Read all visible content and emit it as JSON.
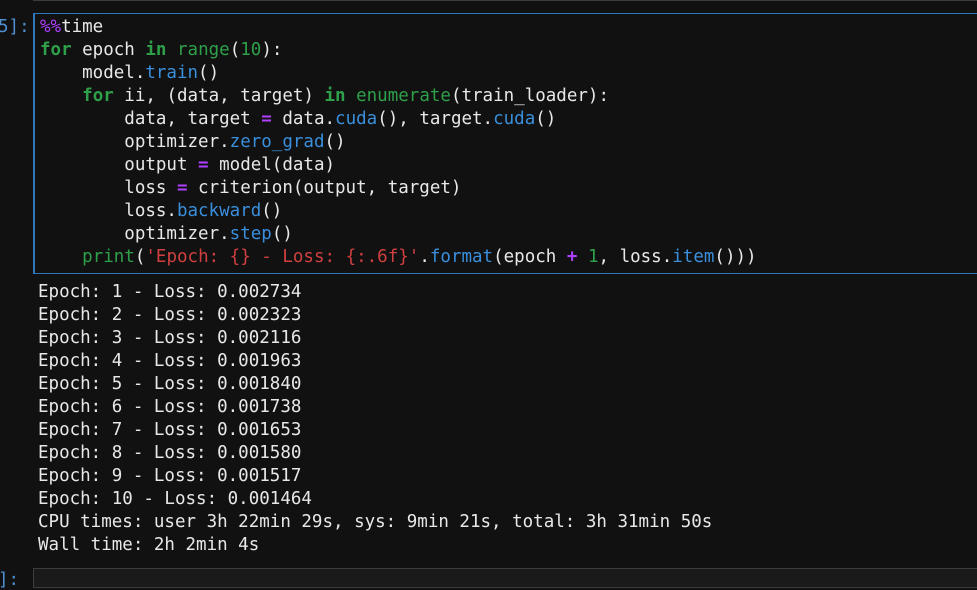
{
  "cell": {
    "prompt": "5]:",
    "next_prompt": "]:",
    "code_lines": [
      [
        {
          "t": "%%",
          "c": "magic"
        },
        {
          "t": "time",
          "c": ""
        }
      ],
      [
        {
          "t": "for",
          "c": "kw"
        },
        {
          "t": " epoch ",
          "c": ""
        },
        {
          "t": "in",
          "c": "kw"
        },
        {
          "t": " ",
          "c": ""
        },
        {
          "t": "range",
          "c": "bi"
        },
        {
          "t": "(",
          "c": ""
        },
        {
          "t": "10",
          "c": "num"
        },
        {
          "t": "):",
          "c": ""
        }
      ],
      [
        {
          "t": "    model.",
          "c": ""
        },
        {
          "t": "train",
          "c": "fn"
        },
        {
          "t": "()",
          "c": ""
        }
      ],
      [
        {
          "t": "    ",
          "c": ""
        },
        {
          "t": "for",
          "c": "kw"
        },
        {
          "t": " ii, (data, target) ",
          "c": ""
        },
        {
          "t": "in",
          "c": "kw"
        },
        {
          "t": " ",
          "c": ""
        },
        {
          "t": "enumerate",
          "c": "bi"
        },
        {
          "t": "(train_loader):",
          "c": ""
        }
      ],
      [
        {
          "t": "        data, target ",
          "c": ""
        },
        {
          "t": "=",
          "c": "op"
        },
        {
          "t": " data.",
          "c": ""
        },
        {
          "t": "cuda",
          "c": "fn"
        },
        {
          "t": "(), target.",
          "c": ""
        },
        {
          "t": "cuda",
          "c": "fn"
        },
        {
          "t": "()",
          "c": ""
        }
      ],
      [
        {
          "t": "        optimizer.",
          "c": ""
        },
        {
          "t": "zero_grad",
          "c": "fn"
        },
        {
          "t": "()",
          "c": ""
        }
      ],
      [
        {
          "t": "        output ",
          "c": ""
        },
        {
          "t": "=",
          "c": "op"
        },
        {
          "t": " model(data)",
          "c": ""
        }
      ],
      [
        {
          "t": "        loss ",
          "c": ""
        },
        {
          "t": "=",
          "c": "op"
        },
        {
          "t": " criterion(output, target)",
          "c": ""
        }
      ],
      [
        {
          "t": "        loss.",
          "c": ""
        },
        {
          "t": "backward",
          "c": "fn"
        },
        {
          "t": "()",
          "c": ""
        }
      ],
      [
        {
          "t": "        optimizer.",
          "c": ""
        },
        {
          "t": "step",
          "c": "fn"
        },
        {
          "t": "()",
          "c": ""
        }
      ],
      [
        {
          "t": "    ",
          "c": ""
        },
        {
          "t": "print",
          "c": "bi"
        },
        {
          "t": "(",
          "c": ""
        },
        {
          "t": "'Epoch: {} - Loss: {:.6f}'",
          "c": "str"
        },
        {
          "t": ".",
          "c": ""
        },
        {
          "t": "format",
          "c": "fn"
        },
        {
          "t": "(epoch ",
          "c": ""
        },
        {
          "t": "+",
          "c": "op"
        },
        {
          "t": " ",
          "c": ""
        },
        {
          "t": "1",
          "c": "num"
        },
        {
          "t": ", loss.",
          "c": ""
        },
        {
          "t": "item",
          "c": "fn"
        },
        {
          "t": "()))",
          "c": ""
        }
      ]
    ],
    "output_lines": [
      "Epoch: 1 - Loss: 0.002734",
      "Epoch: 2 - Loss: 0.002323",
      "Epoch: 3 - Loss: 0.002116",
      "Epoch: 4 - Loss: 0.001963",
      "Epoch: 5 - Loss: 0.001840",
      "Epoch: 6 - Loss: 0.001738",
      "Epoch: 7 - Loss: 0.001653",
      "Epoch: 8 - Loss: 0.001580",
      "Epoch: 9 - Loss: 0.001517",
      "Epoch: 10 - Loss: 0.001464",
      "CPU times: user 3h 22min 29s, sys: 9min 21s, total: 3h 31min 50s",
      "Wall time: 2h 2min 4s"
    ]
  }
}
